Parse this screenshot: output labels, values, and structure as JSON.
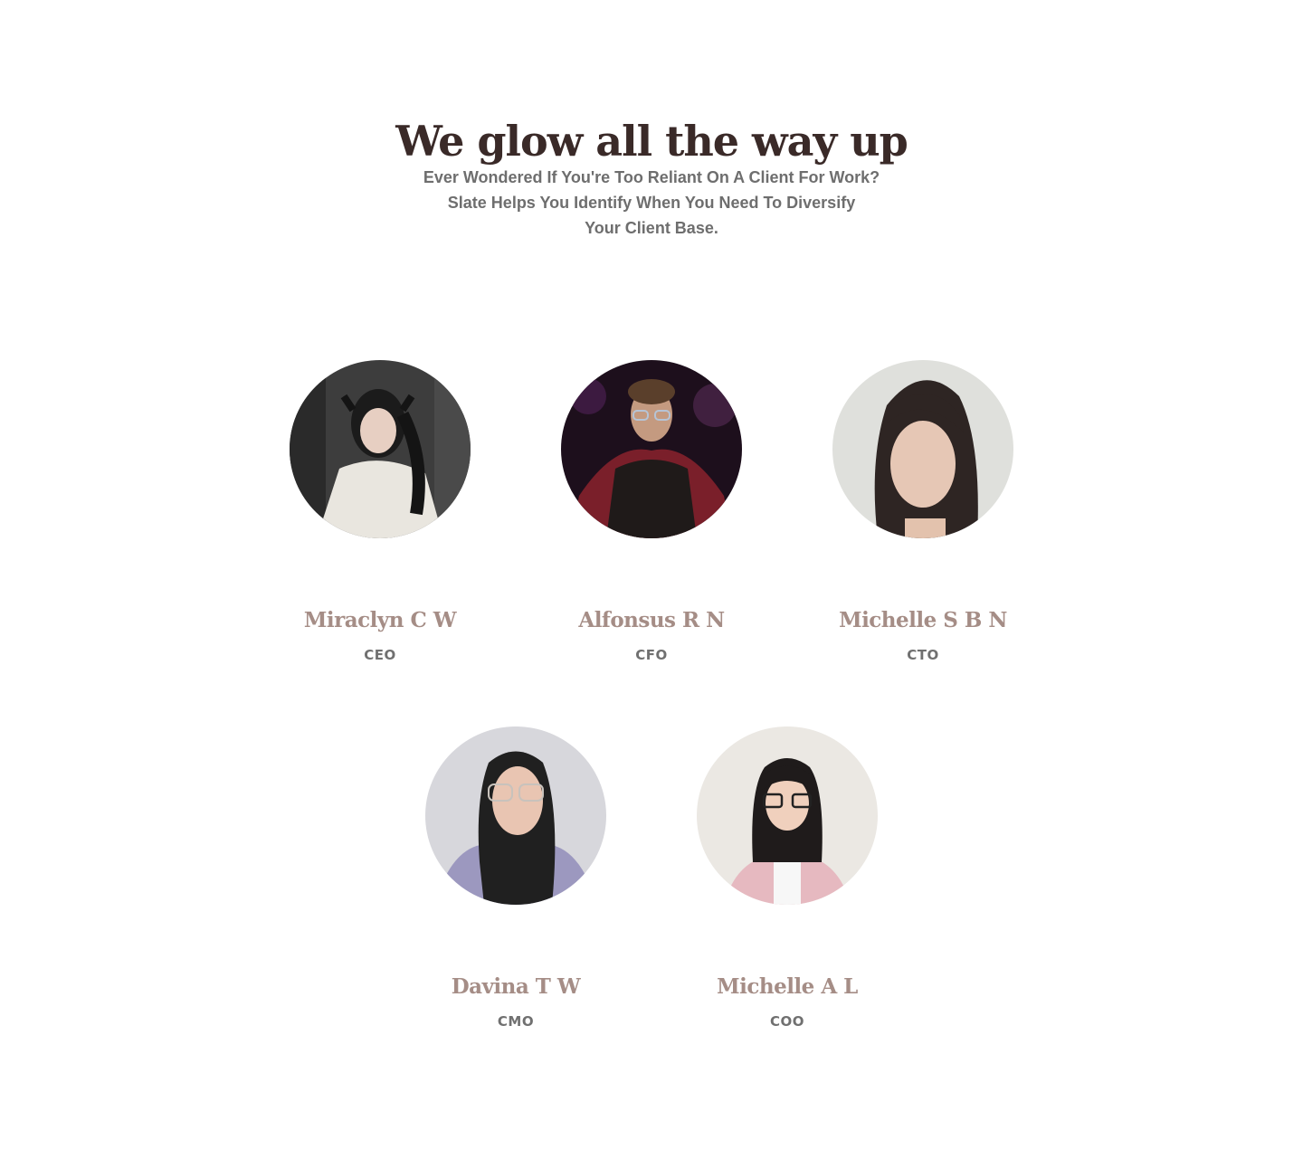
{
  "section": {
    "title": "We glow all the way up",
    "subtitle_lines": [
      "Ever Wondered If You're Too Reliant On A Client For Work?",
      "Slate Helps You Identify When You Need To Diversify",
      "Your Client Base."
    ]
  },
  "team": [
    {
      "name": "Miraclyn C W",
      "role": "CEO"
    },
    {
      "name": "Alfonsus R N",
      "role": "CFO"
    },
    {
      "name": "Michelle S B N",
      "role": "CTO"
    },
    {
      "name": "Davina T W",
      "role": "CMO"
    },
    {
      "name": "Michelle A L",
      "role": "COO"
    }
  ]
}
